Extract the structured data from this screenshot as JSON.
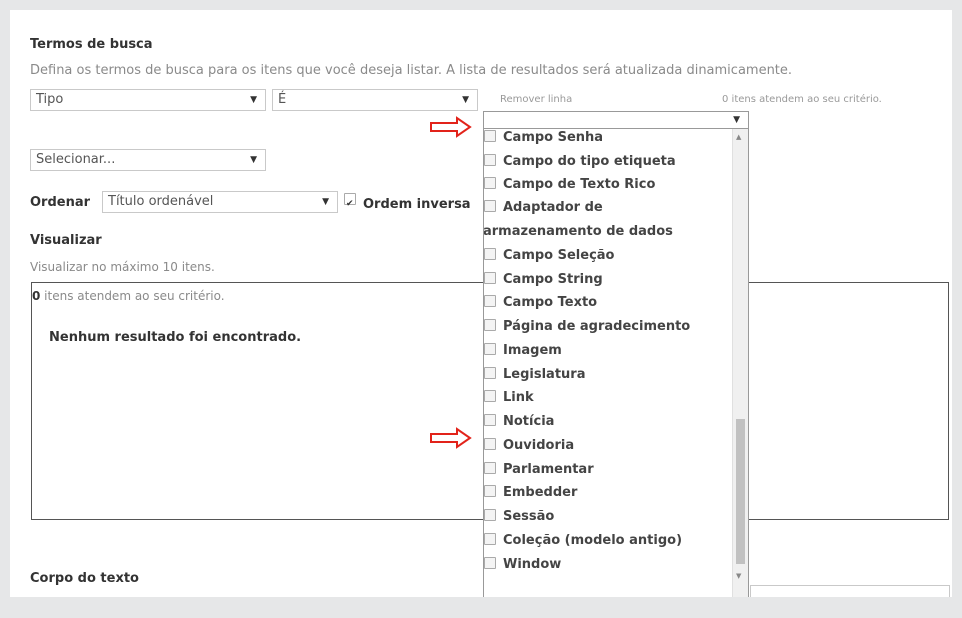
{
  "search": {
    "title": "Termos de busca",
    "description": "Defina os termos de busca para os itens que você deseja listar. A lista de resultados será atualizada dinamicamente.",
    "field_select": "Tipo",
    "operator_select": "É",
    "remove_line": "Remover linha",
    "criteria_count_top": "0 itens atendem ao seu critério.",
    "add_select": "Selecionar..."
  },
  "sort": {
    "label": "Ordenar",
    "select": "Título ordenável",
    "reverse_label": "Ordem inversa",
    "reverse_checked": true
  },
  "view": {
    "title": "Visualizar",
    "description": "Visualizar no máximo 10 itens.",
    "count_bold": "0",
    "count_rest": " itens atendem ao seu critério.",
    "no_results": "Nenhum resultado foi encontrado."
  },
  "body": {
    "label": "Corpo do texto"
  },
  "dropdown": {
    "value": "",
    "options": [
      "Campo Senha",
      "Campo do tipo etiqueta",
      "Campo de Texto Rico",
      "Adaptador de",
      "armazenamento de dados",
      "Campo Seleção",
      "Campo String",
      "Campo Texto",
      "Página de agradecimento",
      "Imagem",
      "Legislatura",
      "Link",
      "Notícia",
      "Ouvidoria",
      "Parlamentar",
      "Embedder",
      "Sessão",
      "Coleção (modelo antigo)",
      "Window"
    ]
  },
  "icons": {
    "annotation_arrow": "red-outline-arrow-icon",
    "dropdown_caret": "caret-down-icon",
    "checkbox": "checkbox-icon"
  },
  "colors": {
    "annotation": "#e2231a",
    "border": "#c9c9c9",
    "background": "#e6e7e8"
  }
}
